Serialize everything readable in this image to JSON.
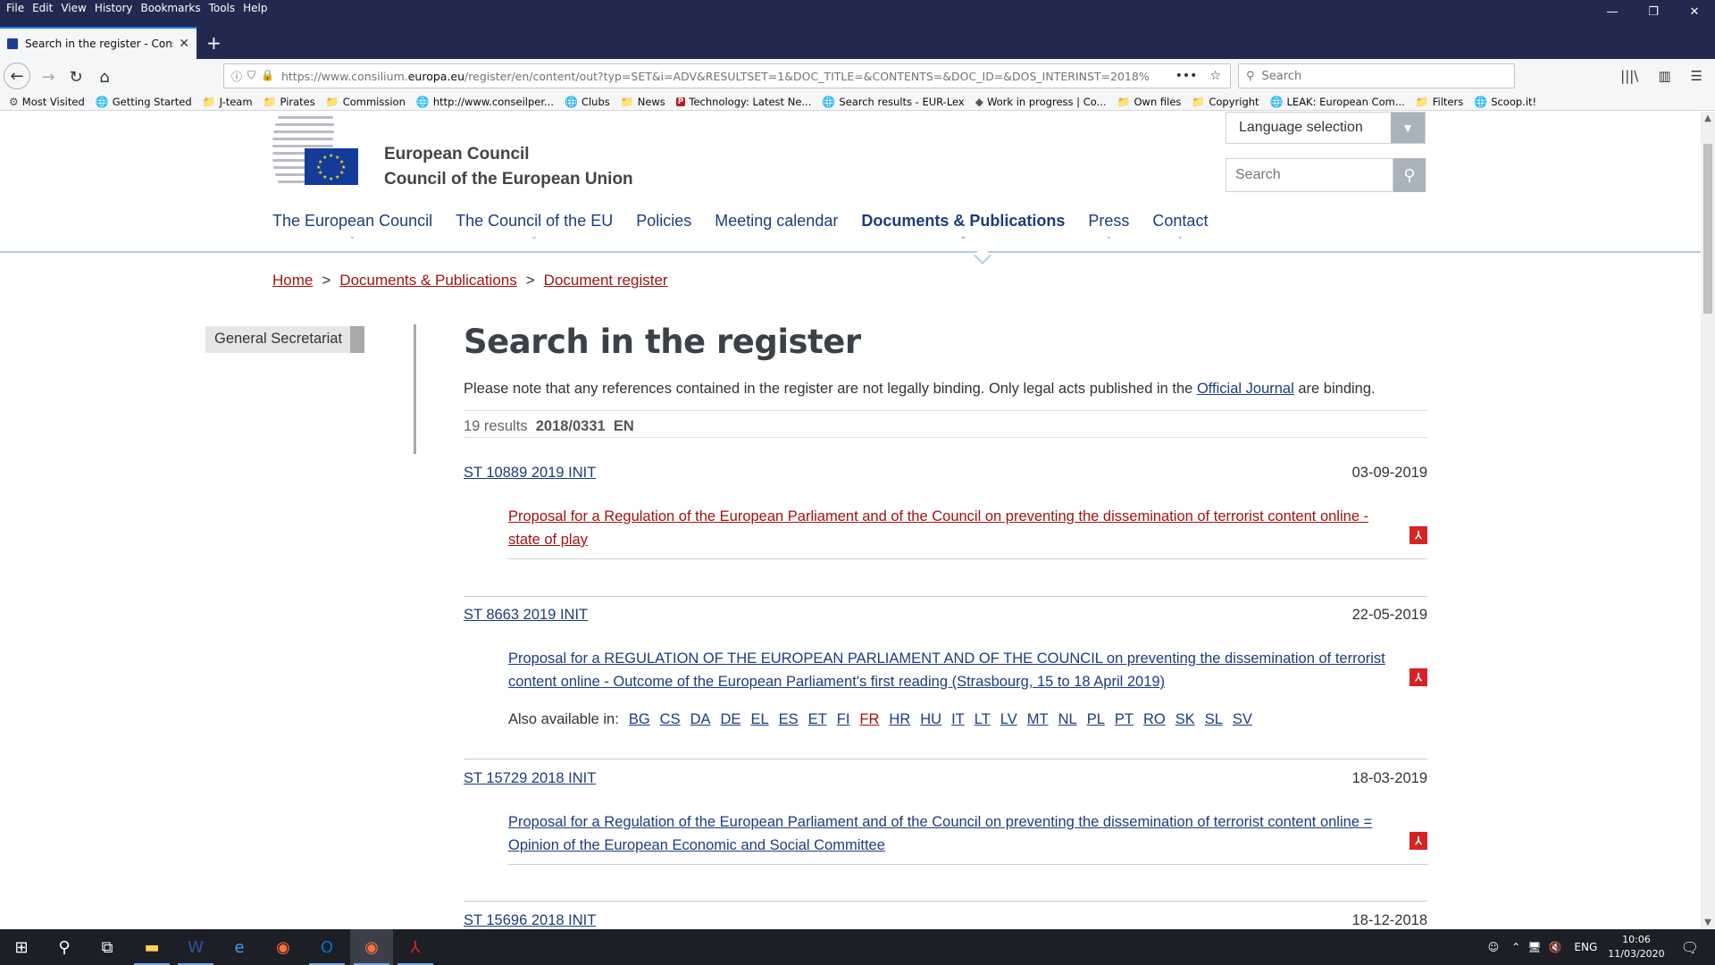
{
  "menu": [
    "File",
    "Edit",
    "View",
    "History",
    "Bookmarks",
    "Tools",
    "Help"
  ],
  "tab": {
    "title": "Search in the register - Consiliu",
    "close": "✕",
    "new": "+"
  },
  "url": {
    "prefix": "https://www.consilium.",
    "domain": "europa.eu",
    "rest": "/register/en/content/out?typ=SET&i=ADV&RESULTSET=1&DOC_TITLE=&CONTENTS=&DOC_ID=&DOS_INTERINST=2018%",
    "more": "•••",
    "star": "☆"
  },
  "search_placeholder": "Search",
  "bookmarks": [
    {
      "icon": "⚙",
      "label": "Most Visited"
    },
    {
      "icon": "🌐",
      "label": "Getting Started"
    },
    {
      "icon": "📁",
      "label": "J-team"
    },
    {
      "icon": "📁",
      "label": "Pirates"
    },
    {
      "icon": "📁",
      "label": "Commission"
    },
    {
      "icon": "🌐",
      "label": "http://www.conseilper..."
    },
    {
      "icon": "🌐",
      "label": "Clubs"
    },
    {
      "icon": "📁",
      "label": "News"
    },
    {
      "icon": "P",
      "label": "Technology: Latest Ne..."
    },
    {
      "icon": "🌐",
      "label": "Search results - EUR-Lex"
    },
    {
      "icon": "◆",
      "label": "Work in progress | Co..."
    },
    {
      "icon": "📁",
      "label": "Own files"
    },
    {
      "icon": "📁",
      "label": "Copyright"
    },
    {
      "icon": "🌐",
      "label": "LEAK: European Com..."
    },
    {
      "icon": "📁",
      "label": "Filters"
    },
    {
      "icon": "🌐",
      "label": "Scoop.it!"
    }
  ],
  "site": {
    "title_line1": "European Council",
    "title_line2": "Council of the European Union",
    "language_selection": "Language selection",
    "search_placeholder": "Search",
    "nav": [
      "The European Council",
      "The Council of the EU",
      "Policies",
      "Meeting calendar",
      "Documents & Publications",
      "Press",
      "Contact"
    ],
    "breadcrumb": [
      "Home",
      "Documents & Publications",
      "Document register"
    ],
    "breadcrumb_sep": ">",
    "side_menu": "General Secretariat"
  },
  "main": {
    "heading": "Search in the register",
    "note_before": "Please note that any references contained in the register are not legally binding. Only legal acts published in the ",
    "note_link": "Official Journal",
    "note_after": " are binding.",
    "results_count": "19 results",
    "results_query": "2018/0331",
    "results_lang": "EN",
    "also_available": "Also available in:",
    "records": [
      {
        "id": "ST 10889 2019 INIT",
        "date": "03-09-2019",
        "title": "Proposal for a Regulation of the European Parliament and of the Council on preventing the dissemination of terrorist content online - state of play"
      },
      {
        "id": "ST 8663 2019 INIT",
        "date": "22-05-2019",
        "title": "Proposal for a REGULATION OF THE EUROPEAN PARLIAMENT AND OF THE COUNCIL on preventing the dissemination of terrorist content online - Outcome of the European Parliament's first reading (Strasbourg, 15 to 18 April 2019)",
        "languages": [
          "BG",
          "CS",
          "DA",
          "DE",
          "EL",
          "ES",
          "ET",
          "FI",
          "FR",
          "HR",
          "HU",
          "IT",
          "LT",
          "LV",
          "MT",
          "NL",
          "PL",
          "PT",
          "RO",
          "SK",
          "SL",
          "SV"
        ]
      },
      {
        "id": "ST 15729 2018 INIT",
        "date": "18-03-2019",
        "title": "Proposal for a Regulation of the European Parliament and of the Council on preventing the dissemination of terrorist content online = Opinion of the European Economic and Social Committee"
      },
      {
        "id": "ST 15696 2018 INIT",
        "date": "18-12-2018"
      }
    ]
  },
  "taskbar": {
    "lang": "ENG",
    "time": "10:06",
    "date": "11/03/2020"
  }
}
